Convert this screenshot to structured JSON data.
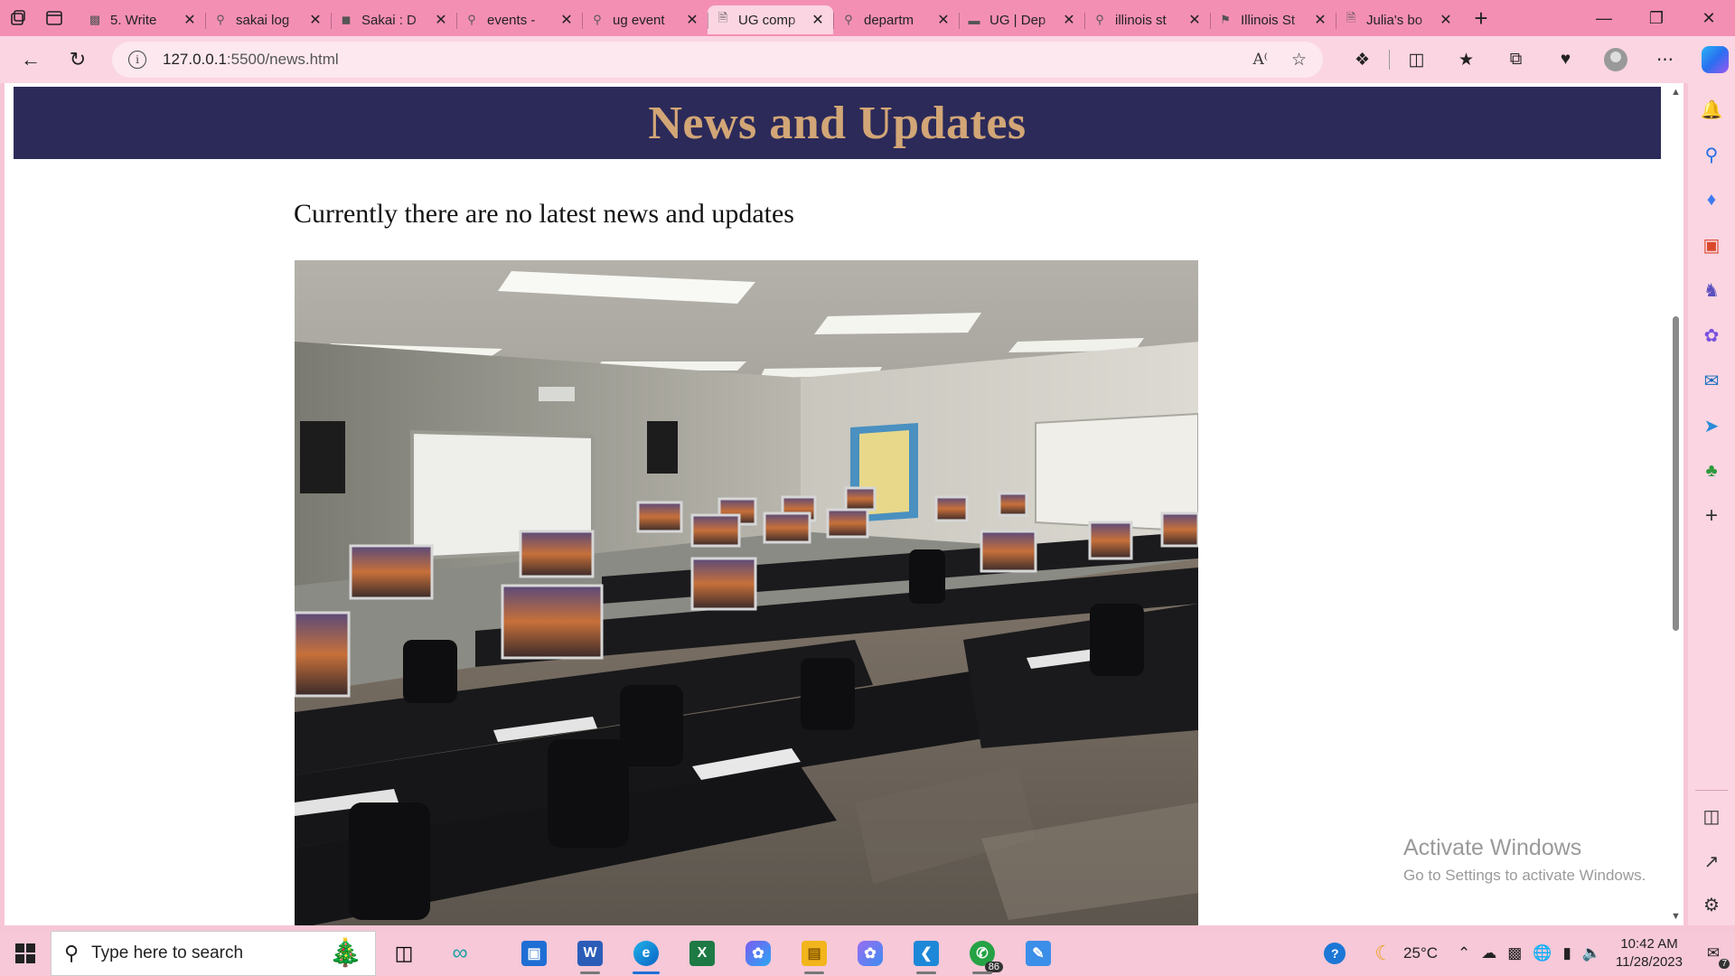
{
  "browser": {
    "tabs": [
      {
        "title": "5. Write",
        "icon": "grid-favicon-icon",
        "active": false
      },
      {
        "title": "sakai log",
        "icon": "search-favicon-icon",
        "active": false
      },
      {
        "title": "Sakai : D",
        "icon": "sakai-favicon-icon",
        "active": false
      },
      {
        "title": "events -",
        "icon": "search-favicon-icon",
        "active": false
      },
      {
        "title": "ug event",
        "icon": "search-favicon-icon",
        "active": false
      },
      {
        "title": "UG comp",
        "icon": "page-favicon-icon",
        "active": true
      },
      {
        "title": "departm",
        "icon": "search-favicon-icon",
        "active": false
      },
      {
        "title": "UG | Dep",
        "icon": "site-favicon-icon",
        "active": false
      },
      {
        "title": "illinois st",
        "icon": "search-favicon-icon",
        "active": false
      },
      {
        "title": "Illinois St",
        "icon": "flag-favicon-icon",
        "active": false
      },
      {
        "title": "Julia's bo",
        "icon": "page-favicon-icon",
        "active": false
      }
    ],
    "address": {
      "host": "127.0.0.1",
      "rest": ":5500/news.html"
    }
  },
  "page": {
    "header_title": "News and Updates",
    "notice": "Currently there are no latest news and updates",
    "photo_description_icon": "computer-lab-photo"
  },
  "watermark": {
    "line1": "Activate Windows",
    "line2": "Go to Settings to activate Windows."
  },
  "taskbar": {
    "search_placeholder": "Type here to search",
    "whatsapp_badge": "86",
    "temperature": "25°C",
    "time": "10:42 AM",
    "date": "11/28/2023",
    "notification_count": "7"
  },
  "colors": {
    "header_bg": "#2c2a59",
    "header_text": "#d2a676",
    "browser_frame": "#f48fb4"
  }
}
